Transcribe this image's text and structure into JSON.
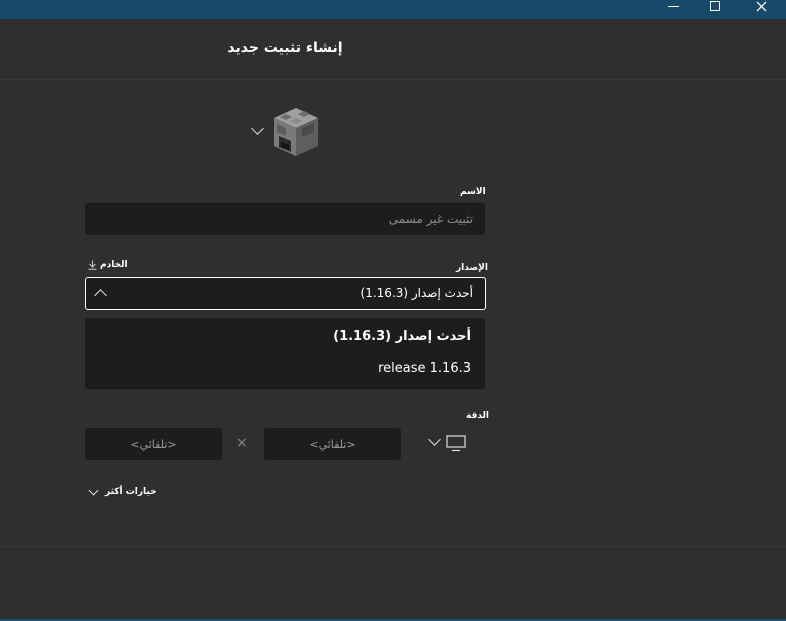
{
  "window": {
    "minimize_icon": "minimize-icon",
    "maximize_icon": "maximize-icon",
    "close_icon": "close-icon"
  },
  "header": {
    "title": "إنشاء تثبيت جديد"
  },
  "form": {
    "name": {
      "label": "الاسم",
      "placeholder": "تثبيت غير مسمى",
      "value": ""
    },
    "version": {
      "label": "الإصدار",
      "selected": "أحدث إصدار (1.16.3)",
      "server_label": "الخادم",
      "options": [
        "أحدث إصدار (1.16.3)",
        "release 1.16.3"
      ]
    },
    "resolution": {
      "label": "الدقة",
      "width_placeholder": "<تلقائي>",
      "height_placeholder": "<تلقائي>",
      "separator": "×"
    },
    "more_options": "خيارات أكثر"
  },
  "colors": {
    "background": "#2f2f2f",
    "field": "#1d1d1d",
    "titlebar": "#174a6a",
    "text": "#ffffff"
  }
}
